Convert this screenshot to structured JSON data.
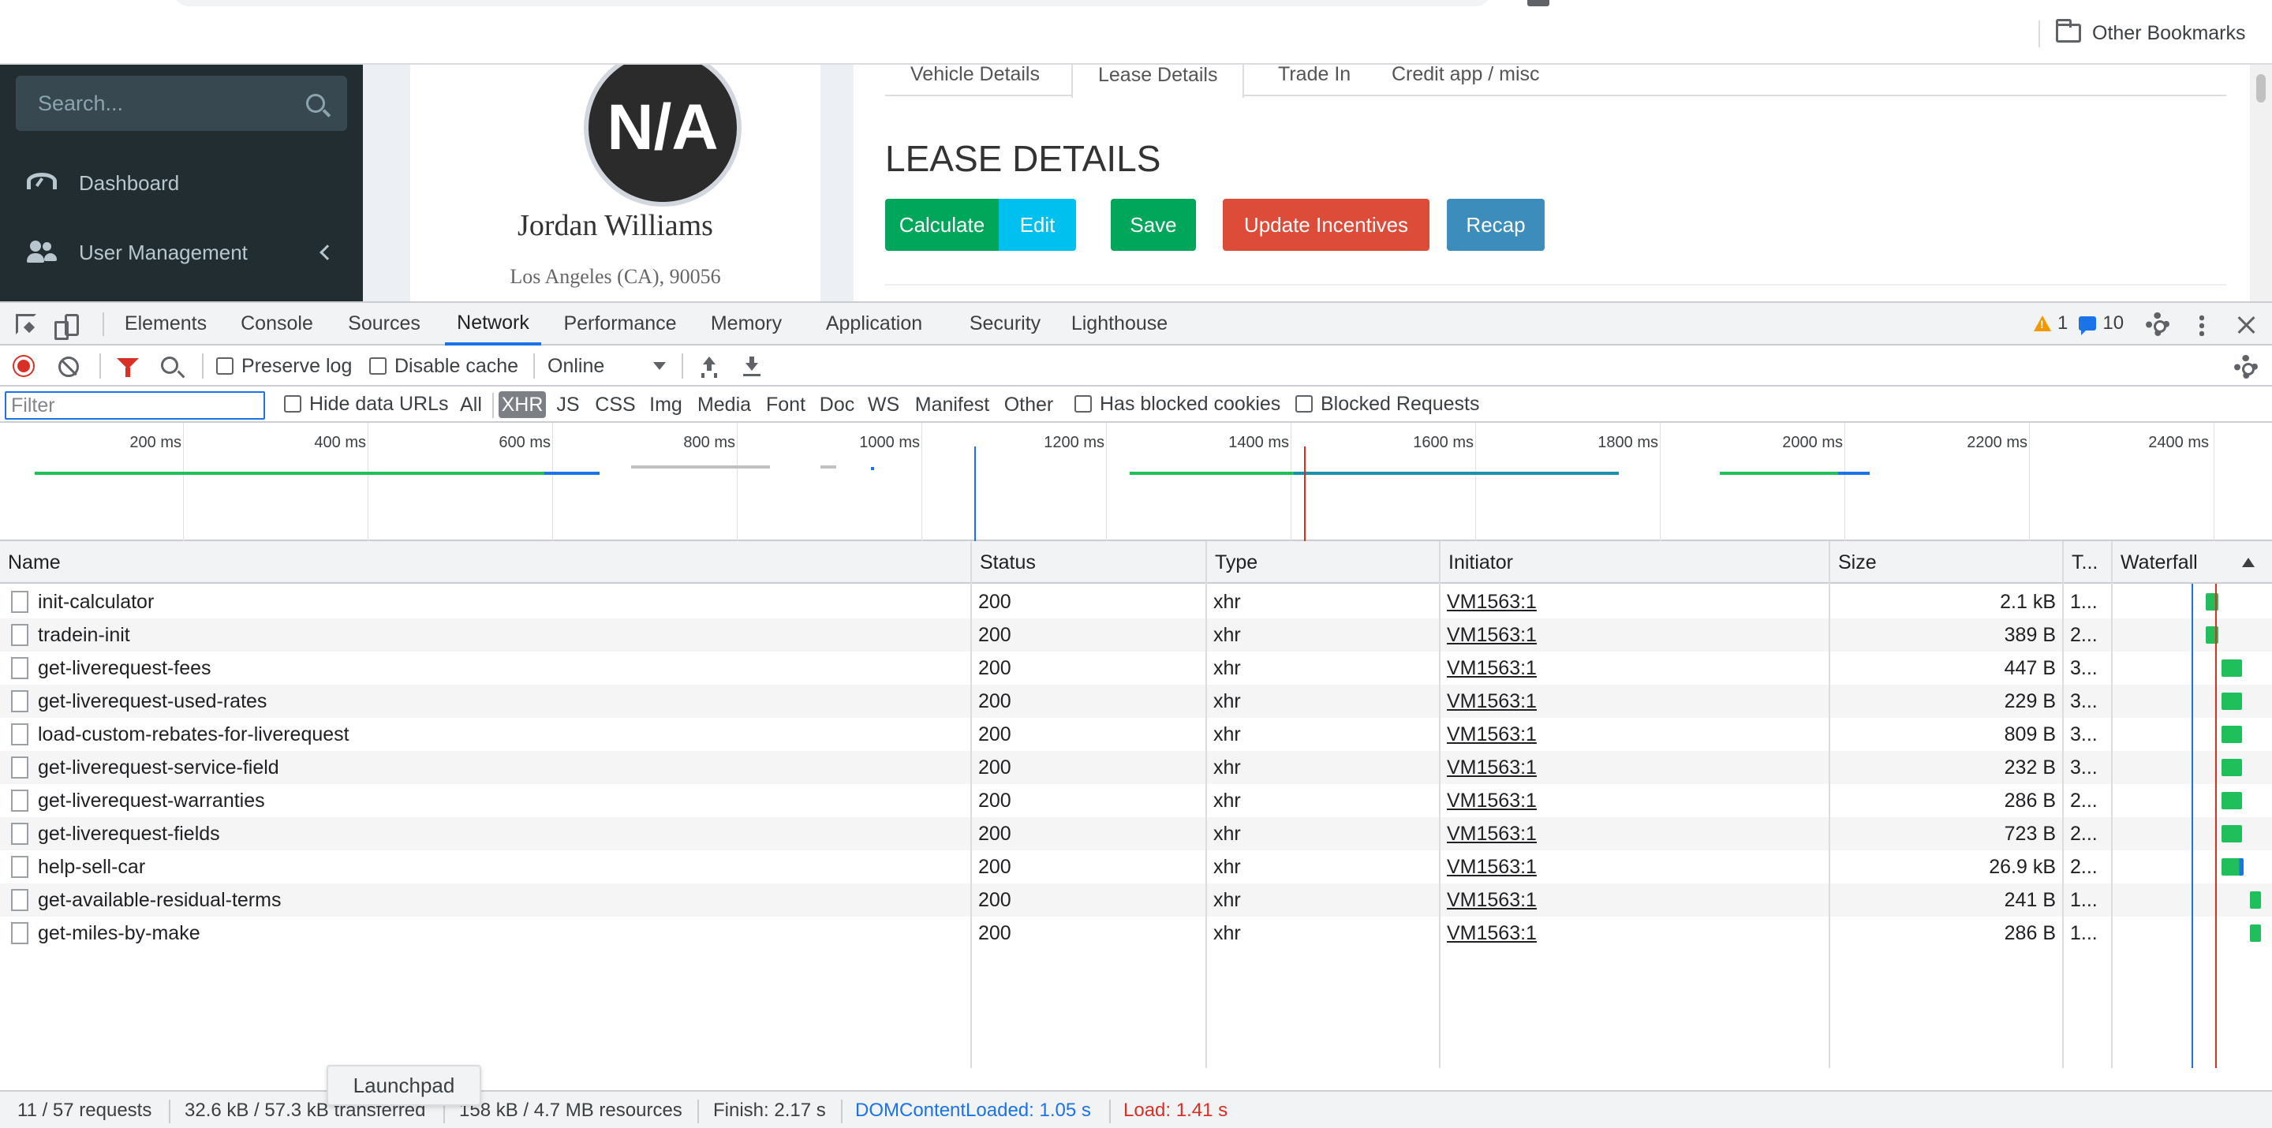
{
  "browser": {
    "bookmarks_bar": {
      "other_bookmarks": "Other Bookmarks"
    }
  },
  "page": {
    "sidebar": {
      "search_placeholder": "Search...",
      "items": [
        {
          "label": "Dashboard",
          "icon": "dashboard-icon"
        },
        {
          "label": "User Management",
          "icon": "users-icon"
        }
      ]
    },
    "profile": {
      "avatar_text": "N/A",
      "name": "Jordan Williams",
      "location": "Los Angeles (CA), 90056"
    },
    "tabs": [
      "Vehicle Details",
      "Lease Details",
      "Trade In",
      "Credit app / misc"
    ],
    "active_tab": "Lease Details",
    "section_title": "LEASE DETAILS",
    "buttons": {
      "calculate": "Calculate",
      "edit": "Edit",
      "save": "Save",
      "update_incentives": "Update Incentives",
      "recap": "Recap"
    },
    "colors": {
      "success": "#00a65a",
      "info": "#00c0ef",
      "danger": "#dd4b39",
      "primary": "#3c8dbc",
      "sidebar": "#222d32"
    }
  },
  "devtools": {
    "tabs": [
      "Elements",
      "Console",
      "Sources",
      "Network",
      "Performance",
      "Memory",
      "Application",
      "Security",
      "Lighthouse"
    ],
    "active_tab": "Network",
    "issues": {
      "warnings": "1",
      "messages": "10"
    },
    "toolbar": {
      "preserve_log": "Preserve log",
      "disable_cache": "Disable cache",
      "throttling": "Online"
    },
    "filter": {
      "placeholder": "Filter",
      "hide_data_urls": "Hide data URLs",
      "types": [
        "All",
        "XHR",
        "JS",
        "CSS",
        "Img",
        "Media",
        "Font",
        "Doc",
        "WS",
        "Manifest",
        "Other"
      ],
      "active_type": "XHR",
      "has_blocked_cookies": "Has blocked cookies",
      "blocked_requests": "Blocked Requests"
    },
    "overview": {
      "ticks": [
        "200 ms",
        "400 ms",
        "600 ms",
        "800 ms",
        "1000 ms",
        "1200 ms",
        "1400 ms",
        "1600 ms",
        "1800 ms",
        "2000 ms",
        "2200 ms",
        "2400 ms"
      ]
    },
    "columns": {
      "name": "Name",
      "status": "Status",
      "type": "Type",
      "initiator": "Initiator",
      "size": "Size",
      "time": "T...",
      "waterfall": "Waterfall"
    },
    "requests": [
      {
        "name": "init-calculator",
        "status": "200",
        "type": "xhr",
        "initiator": "VM1563:1",
        "size": "2.1 kB",
        "time": "1..."
      },
      {
        "name": "tradein-init",
        "status": "200",
        "type": "xhr",
        "initiator": "VM1563:1",
        "size": "389 B",
        "time": "2..."
      },
      {
        "name": "get-liverequest-fees",
        "status": "200",
        "type": "xhr",
        "initiator": "VM1563:1",
        "size": "447 B",
        "time": "3..."
      },
      {
        "name": "get-liverequest-used-rates",
        "status": "200",
        "type": "xhr",
        "initiator": "VM1563:1",
        "size": "229 B",
        "time": "3..."
      },
      {
        "name": "load-custom-rebates-for-liverequest",
        "status": "200",
        "type": "xhr",
        "initiator": "VM1563:1",
        "size": "809 B",
        "time": "3..."
      },
      {
        "name": "get-liverequest-service-field",
        "status": "200",
        "type": "xhr",
        "initiator": "VM1563:1",
        "size": "232 B",
        "time": "3..."
      },
      {
        "name": "get-liverequest-warranties",
        "status": "200",
        "type": "xhr",
        "initiator": "VM1563:1",
        "size": "286 B",
        "time": "2..."
      },
      {
        "name": "get-liverequest-fields",
        "status": "200",
        "type": "xhr",
        "initiator": "VM1563:1",
        "size": "723 B",
        "time": "2..."
      },
      {
        "name": "help-sell-car",
        "status": "200",
        "type": "xhr",
        "initiator": "VM1563:1",
        "size": "26.9 kB",
        "time": "2..."
      },
      {
        "name": "get-available-residual-terms",
        "status": "200",
        "type": "xhr",
        "initiator": "VM1563:1",
        "size": "241 B",
        "time": "1..."
      },
      {
        "name": "get-miles-by-make",
        "status": "200",
        "type": "xhr",
        "initiator": "VM1563:1",
        "size": "286 B",
        "time": "1..."
      }
    ],
    "status_bar": {
      "requests": "11 / 57 requests",
      "transferred": "32.6 kB / 57.3 kB transferred",
      "resources": "158 kB / 4.7 MB resources",
      "finish": "Finish: 2.17 s",
      "dom_content_loaded": "DOMContentLoaded: 1.05 s",
      "load": "Load: 1.41 s"
    },
    "tooltip": "Launchpad",
    "colors": {
      "accent": "#1a73e8",
      "record": "#d93025",
      "bar": "#1fbf5b"
    }
  }
}
